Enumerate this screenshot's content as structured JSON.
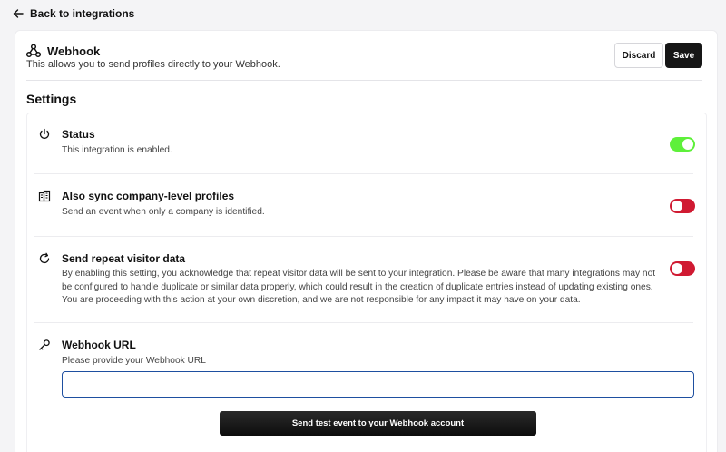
{
  "topbar": {
    "back_label": "Back to integrations"
  },
  "header": {
    "title": "Webhook",
    "subtitle": "This allows you to send profiles directly to your Webhook.",
    "discard_label": "Discard",
    "save_label": "Save"
  },
  "settings": {
    "title": "Settings",
    "rows": [
      {
        "icon": "power-icon",
        "title": "Status",
        "description": "This integration is enabled.",
        "toggle": "on"
      },
      {
        "icon": "buildings-icon",
        "title": "Also sync company-level profiles",
        "description": "Send an event when only a company is identified.",
        "toggle": "off"
      },
      {
        "icon": "refresh-icon",
        "title": "Send repeat visitor data",
        "description": "By enabling this setting, you acknowledge that repeat visitor data will be sent to your integration. Please be aware that many integrations may not be configured to handle duplicate or similar data properly, which could result in the creation of duplicate entries instead of updating existing ones. You are proceeding with this action at your own discretion, and we are not responsible for any impact it may have on your data.",
        "toggle": "off"
      }
    ],
    "webhook": {
      "icon": "key-icon",
      "title": "Webhook URL",
      "description": "Please provide your Webhook URL",
      "value": "",
      "placeholder": "",
      "test_button_label": "Send test event to your Webhook account"
    }
  },
  "colors": {
    "toggle_on": "#5ef03a",
    "toggle_off": "#d01a32",
    "primary_button": "#161616",
    "input_focus": "#1e4fa0"
  }
}
